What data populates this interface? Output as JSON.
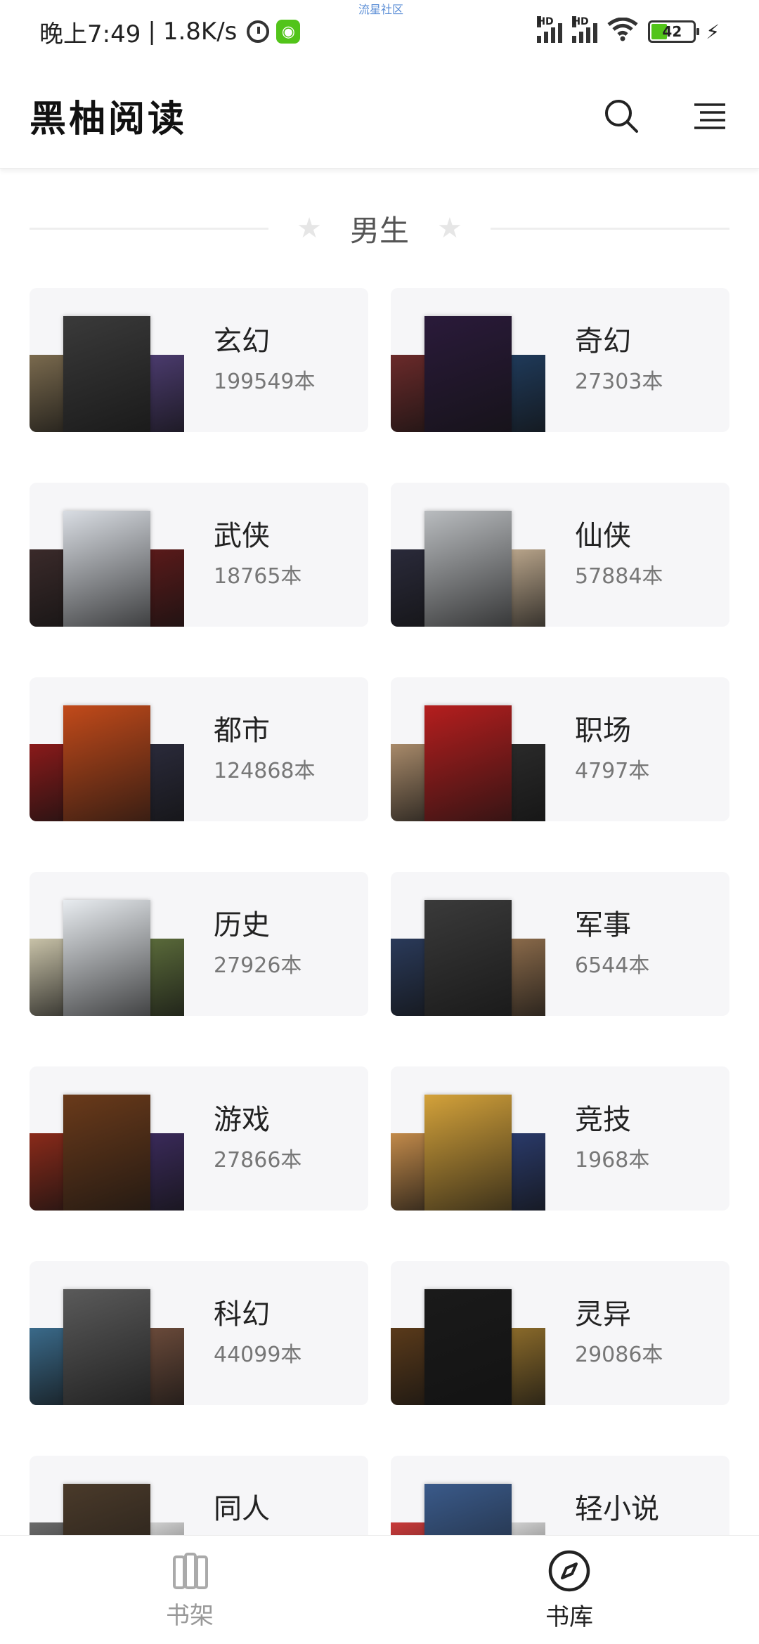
{
  "status": {
    "time": "晚上7:49",
    "speed": "1.8K/s",
    "battery": "42",
    "network_label": "HD",
    "watermark": "流星社区"
  },
  "appbar": {
    "title": "黑柚阅读",
    "search_icon": "search-icon",
    "menu_icon": "menu-icon"
  },
  "section": {
    "label": "男生"
  },
  "categories": [
    {
      "name": "玄幻",
      "count": "199549本",
      "colors": [
        "#7a6a4e",
        "#3a3a3a",
        "#4b3b6e"
      ]
    },
    {
      "name": "奇幻",
      "count": "27303本",
      "colors": [
        "#6b2a2a",
        "#2a1a3a",
        "#1f3a5a"
      ]
    },
    {
      "name": "武侠",
      "count": "18765本",
      "colors": [
        "#3a2a2a",
        "#d9dde3",
        "#5a1a1a"
      ]
    },
    {
      "name": "仙侠",
      "count": "57884本",
      "colors": [
        "#2a2a3a",
        "#b9bcbf",
        "#b8a48a"
      ]
    },
    {
      "name": "都市",
      "count": "124868本",
      "colors": [
        "#8a1a1a",
        "#c24a1a",
        "#2a2a3a"
      ]
    },
    {
      "name": "职场",
      "count": "4797本",
      "colors": [
        "#a88a6a",
        "#b51e1e",
        "#2a2a2a"
      ]
    },
    {
      "name": "历史",
      "count": "27926本",
      "colors": [
        "#c8c2a8",
        "#e8ecf0",
        "#5a6a3a"
      ]
    },
    {
      "name": "军事",
      "count": "6544本",
      "colors": [
        "#2a3a5a",
        "#3a3a3a",
        "#8a6a4a"
      ]
    },
    {
      "name": "游戏",
      "count": "27866本",
      "colors": [
        "#8a2a1a",
        "#6a3a1a",
        "#3a2a5a"
      ]
    },
    {
      "name": "竞技",
      "count": "1968本",
      "colors": [
        "#c28a4a",
        "#d4a23a",
        "#2a3a6a"
      ]
    },
    {
      "name": "科幻",
      "count": "44099本",
      "colors": [
        "#3a6a8a",
        "#5a5a5a",
        "#6a4a3a"
      ]
    },
    {
      "name": "灵异",
      "count": "29086本",
      "colors": [
        "#5a3a1a",
        "#1a1a1a",
        "#8a6a2a"
      ]
    },
    {
      "name": "同人",
      "count": "",
      "colors": [
        "#6a6a6a",
        "#4a3a2a",
        "#d0d0d0"
      ]
    },
    {
      "name": "轻小说",
      "count": "",
      "colors": [
        "#c83a3a",
        "#3a5a8a",
        "#d0d0d0"
      ]
    }
  ],
  "bottom_nav": [
    {
      "label": "书架",
      "icon": "bookshelf-icon",
      "active": false
    },
    {
      "label": "书库",
      "icon": "compass-icon",
      "active": true
    }
  ]
}
